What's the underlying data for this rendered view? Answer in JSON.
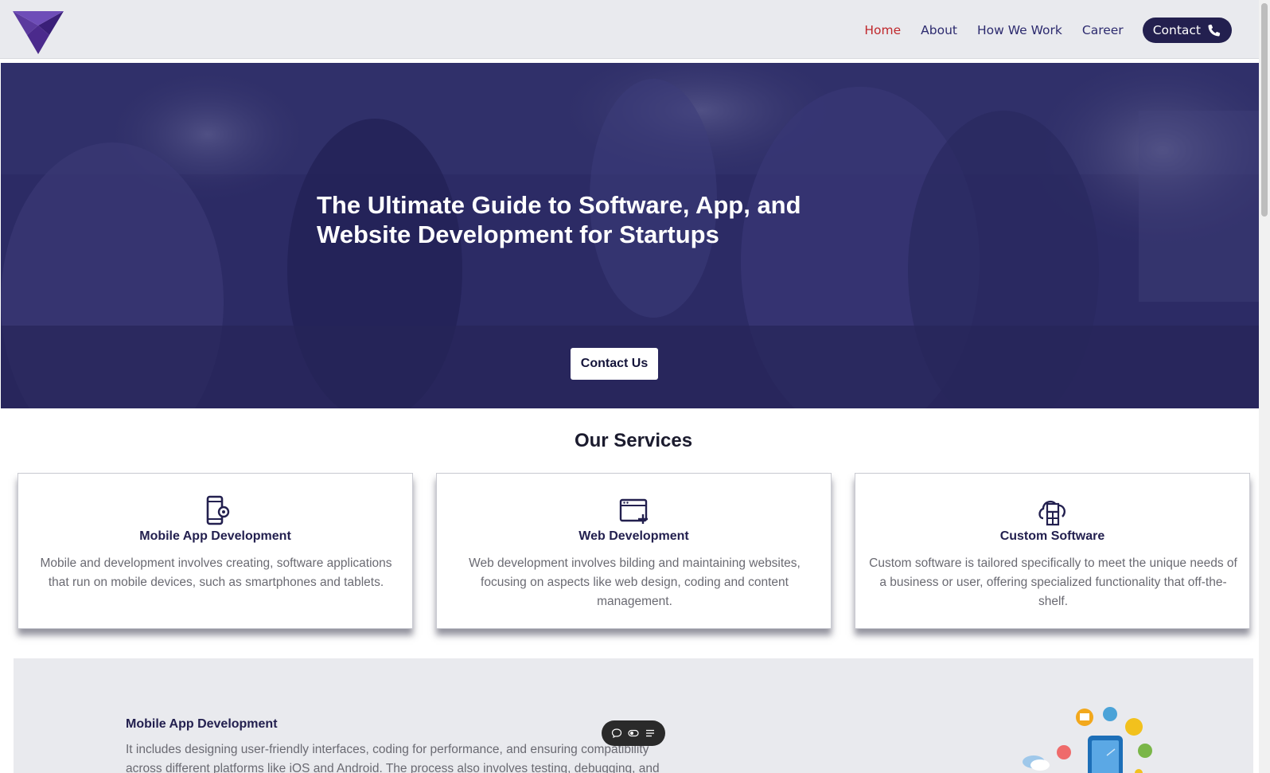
{
  "nav": {
    "links": [
      "Home",
      "About",
      "How We Work",
      "Career"
    ],
    "active_index": 0,
    "contact_label": "Contact"
  },
  "hero": {
    "title": "The Ultimate Guide to Software, App, and Website Development for Startups",
    "cta_label": "Contact Us"
  },
  "services": {
    "title": "Our Services",
    "cards": [
      {
        "icon": "mobile-gear-icon",
        "title": "Mobile App Development",
        "text": "Mobile and development involves creating, software applications that run on mobile devices, such as smartphones and tablets."
      },
      {
        "icon": "browser-add-icon",
        "title": "Web Development",
        "text": "Web development involves bilding and maintaining websites, focusing on aspects like web design, coding and content management."
      },
      {
        "icon": "custom-software-icon",
        "title": "Custom Software",
        "text": "Custom software is tailored specifically to meet the unique needs of a business or user, offering specialized functionality that off-the-shelf."
      }
    ]
  },
  "detail": {
    "title": "Mobile App Development",
    "text": "It includes designing user-friendly interfaces, coding for performance, and ensuring compatibility across different platforms like iOS and Android. The process also involves testing, debugging, and"
  },
  "colors": {
    "brand_navy": "#23204f",
    "nav_active": "#c0282c",
    "hero_overlay": "#2b2a63",
    "logo_purple": "#4b2a8c"
  }
}
